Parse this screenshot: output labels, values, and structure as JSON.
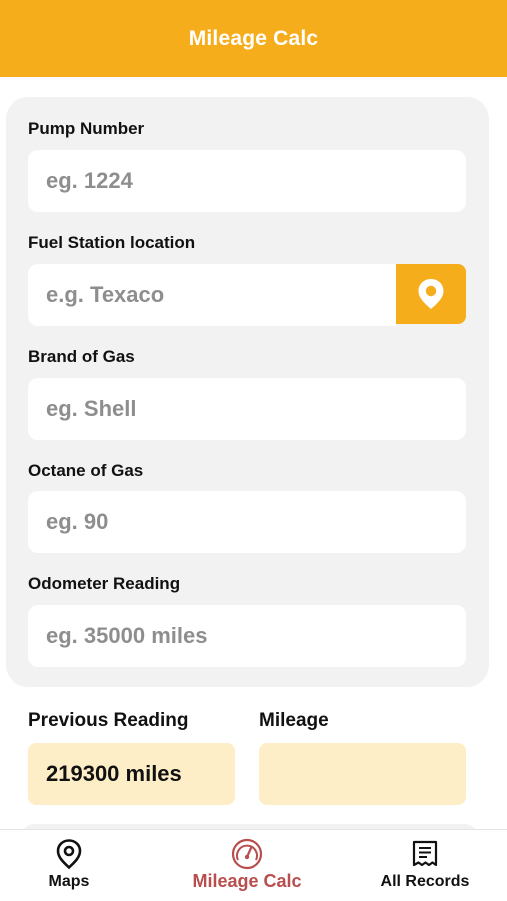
{
  "header": {
    "title": "Mileage Calc"
  },
  "form": {
    "pump_number": {
      "label": "Pump Number",
      "placeholder": "eg. 1224",
      "value": ""
    },
    "fuel_station": {
      "label": "Fuel Station location",
      "placeholder": "e.g. Texaco",
      "value": ""
    },
    "brand": {
      "label": "Brand of Gas",
      "placeholder": "eg. Shell",
      "value": ""
    },
    "octane": {
      "label": "Octane of Gas",
      "placeholder": "eg. 90",
      "value": ""
    },
    "odometer": {
      "label": "Odometer Reading",
      "placeholder": "eg. 35000 miles",
      "value": ""
    }
  },
  "readings": {
    "previous_label": "Previous Reading",
    "previous_value": "219300 miles",
    "mileage_label": "Mileage",
    "mileage_value": ""
  },
  "tabs": [
    {
      "label": "Maps",
      "icon": "map-pin-icon",
      "active": false
    },
    {
      "label": "Mileage Calc",
      "icon": "gauge-icon",
      "active": true
    },
    {
      "label": "All Records",
      "icon": "receipt-icon",
      "active": false
    }
  ],
  "colors": {
    "accent": "#f5ad1b",
    "active_tab": "#b84e4e",
    "reading_bg": "#fdeec8",
    "card_bg": "#f2f2f2"
  }
}
